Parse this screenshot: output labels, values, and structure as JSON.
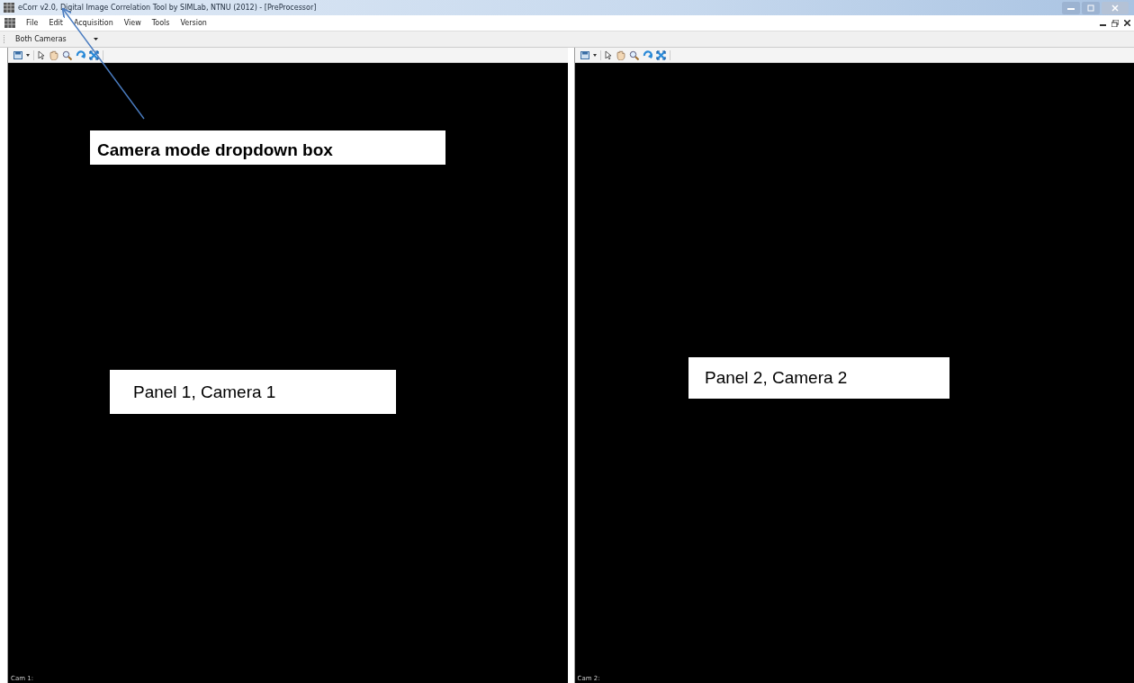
{
  "window": {
    "title": "eCorr v2.0, Digital Image Correlation Tool  by SIMLab, NTNU (2012) - [PreProcessor]"
  },
  "menu": [
    "File",
    "Edit",
    "Acquisition",
    "View",
    "Tools",
    "Version"
  ],
  "camera_mode": {
    "value": "Both Cameras"
  },
  "panels": [
    {
      "label": "Cam 1:"
    },
    {
      "label": "Cam 2:"
    }
  ],
  "annotations": [
    {
      "kind": "callout",
      "text": "Camera mode dropdown box"
    },
    {
      "kind": "box",
      "text": "Panel 1, Camera 1"
    },
    {
      "kind": "box",
      "text": "Panel 2, Camera 2"
    }
  ]
}
